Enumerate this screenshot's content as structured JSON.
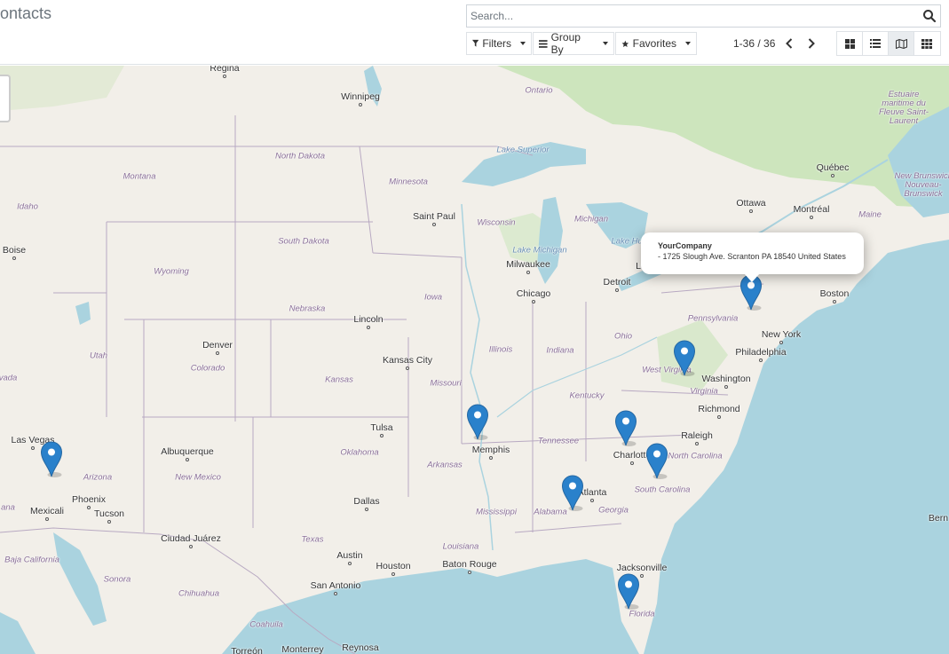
{
  "breadcrumb": "ontacts",
  "search": {
    "placeholder": "Search..."
  },
  "filters": {
    "filters_label": "Filters",
    "groupby_label": "Group By",
    "favorites_label": "Favorites"
  },
  "pager": {
    "value": "1-36 / 36"
  },
  "views": [
    "kanban",
    "list",
    "map",
    "grid"
  ],
  "active_view": "map",
  "colors": {
    "marker": "#2a81cb",
    "water": "#aad3df",
    "land": "#f2efe9",
    "forest": "#cde5bd"
  },
  "popup": {
    "title": "YourCompany",
    "address": "- 1725 Slough Ave. Scranton PA 18540 United States"
  },
  "map_labels": {
    "cities": [
      "Regina",
      "Winnipeg",
      "Québec",
      "Ottawa",
      "Montréal",
      "Saint Paul",
      "Boise",
      "Milwaukee",
      "Detroit",
      "Chicago",
      "Boston",
      "Lincoln",
      "Denver",
      "New York",
      "Philadelphia",
      "Kansas City",
      "Washington",
      "Richmond",
      "Raleigh",
      "Tulsa",
      "Las Vegas",
      "Albuquerque",
      "Memphis",
      "Charlotte",
      "Atlanta",
      "Phoenix",
      "Mexicali",
      "Tucson",
      "Dallas",
      "Ciudad Juárez",
      "Austin",
      "Houston",
      "Baton Rouge",
      "Jacksonville",
      "San Antonio",
      "Monterrey",
      "Reynosa",
      "Torreón",
      "Bern",
      "Lo"
    ],
    "states": [
      "Ontario",
      "North Dakota",
      "Montana",
      "Minnesota",
      "Idaho",
      "South Dakota",
      "Wisconsin",
      "Michigan",
      "Wyoming",
      "Iowa",
      "Nebraska",
      "Pennsylvania",
      "Ohio",
      "Utah",
      "Illinois",
      "Indiana",
      "Colorado",
      "West Virginia",
      "Virginia",
      "Kansas",
      "Missouri",
      "Kentucky",
      "Tennessee",
      "North Carolina",
      "Arizona",
      "New Mexico",
      "Oklahoma",
      "Arkansas",
      "South Carolina",
      "Mississippi",
      "Alabama",
      "Georgia",
      "Texas",
      "Louisiana",
      "Florida",
      "Baja California",
      "Sonora",
      "Chihuahua",
      "Coahuila",
      "Maine",
      "vada",
      "ana"
    ],
    "water": [
      "Lake Superior",
      "Lake Michigan",
      "Lake Huron"
    ],
    "provinces": [
      "Estuaire maritime du Fleuve Saint-Laurent",
      "New Brunswick Nouveau-Brunswick"
    ]
  }
}
